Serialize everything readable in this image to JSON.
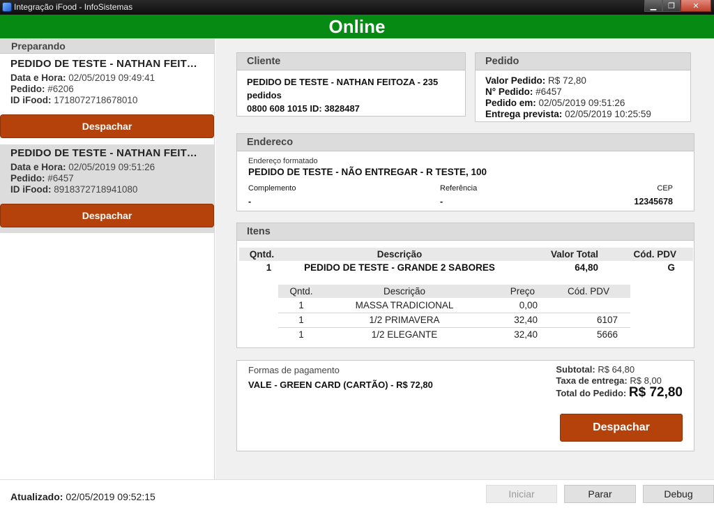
{
  "window": {
    "title": "Integração iFood - InfoSistemas",
    "minimize": "▁",
    "maximize": "❐",
    "close": "✕"
  },
  "banner": {
    "status": "Online"
  },
  "sidebar": {
    "heading": "Preparando",
    "orders": [
      {
        "title": "PEDIDO DE TESTE - NATHAN FEITOZA",
        "datetime_label": "Data e Hora:",
        "datetime": "02/05/2019 09:49:41",
        "order_label": "Pedido:",
        "order": "#6206",
        "ifood_label": "ID iFood:",
        "ifood_id": "1718072718678010",
        "dispatch_label": "Despachar"
      },
      {
        "title": "PEDIDO DE TESTE - NATHAN FEITOZA",
        "datetime_label": "Data e Hora:",
        "datetime": "02/05/2019 09:51:26",
        "order_label": "Pedido:",
        "order": "#6457",
        "ifood_label": "ID iFood:",
        "ifood_id": "8918372718941080",
        "dispatch_label": "Despachar"
      }
    ]
  },
  "client": {
    "heading": "Cliente",
    "name": "PEDIDO DE TESTE - NATHAN FEITOZA - 235 pedidos",
    "phone_line": "0800 608 1015 ID: 3828487"
  },
  "order": {
    "heading": "Pedido",
    "value_label": "Valor Pedido:",
    "value": "R$ 72,80",
    "number_label": "N° Pedido:",
    "number": "#6457",
    "placed_label": "Pedido em:",
    "placed": "02/05/2019 09:51:26",
    "delivery_label": "Entrega prevista:",
    "delivery": "02/05/2019 10:25:59"
  },
  "address": {
    "heading": "Endereco",
    "formatted_label": "Endereço formatado",
    "formatted": "PEDIDO DE TESTE - NÃO ENTREGAR - R TESTE, 100",
    "complement_label": "Complemento",
    "complement": "-",
    "reference_label": "Referência",
    "reference": "-",
    "cep_label": "CEP",
    "cep": "12345678"
  },
  "items": {
    "heading": "Itens",
    "columns": {
      "qty": "Qntd.",
      "desc": "Descrição",
      "total": "Valor Total",
      "pdv": "Cód. PDV"
    },
    "row": {
      "qty": "1",
      "desc": "PEDIDO DE TESTE - GRANDE 2 SABORES",
      "total": "64,80",
      "pdv": "G"
    },
    "sub_columns": {
      "qty": "Qntd.",
      "desc": "Descrição",
      "price": "Preço",
      "pdv": "Cód. PDV"
    },
    "sub_rows": [
      {
        "qty": "1",
        "desc": "MASSA TRADICIONAL",
        "price": "0,00",
        "pdv": ""
      },
      {
        "qty": "1",
        "desc": "1/2 PRIMAVERA",
        "price": "32,40",
        "pdv": "6107"
      },
      {
        "qty": "1",
        "desc": "1/2 ELEGANTE",
        "price": "32,40",
        "pdv": "5666"
      }
    ]
  },
  "payment": {
    "label": "Formas de pagamento",
    "method": "VALE - GREEN CARD (CARTÃO) - R$ 72,80",
    "subtotal_label": "Subtotal:",
    "subtotal": "R$ 64,80",
    "delivery_fee_label": "Taxa de entrega:",
    "delivery_fee": "R$ 8,00",
    "total_label": "Total do Pedido:",
    "total": "R$ 72,80",
    "dispatch_label": "Despachar"
  },
  "footer": {
    "updated_label": "Atualizado:",
    "updated": "02/05/2019 09:52:15",
    "start_label": "Iniciar",
    "stop_label": "Parar",
    "debug_label": "Debug"
  },
  "colors": {
    "online_green": "#078a14",
    "dispatch_orange": "#b5420b",
    "panel_header": "#dcdcdc"
  }
}
